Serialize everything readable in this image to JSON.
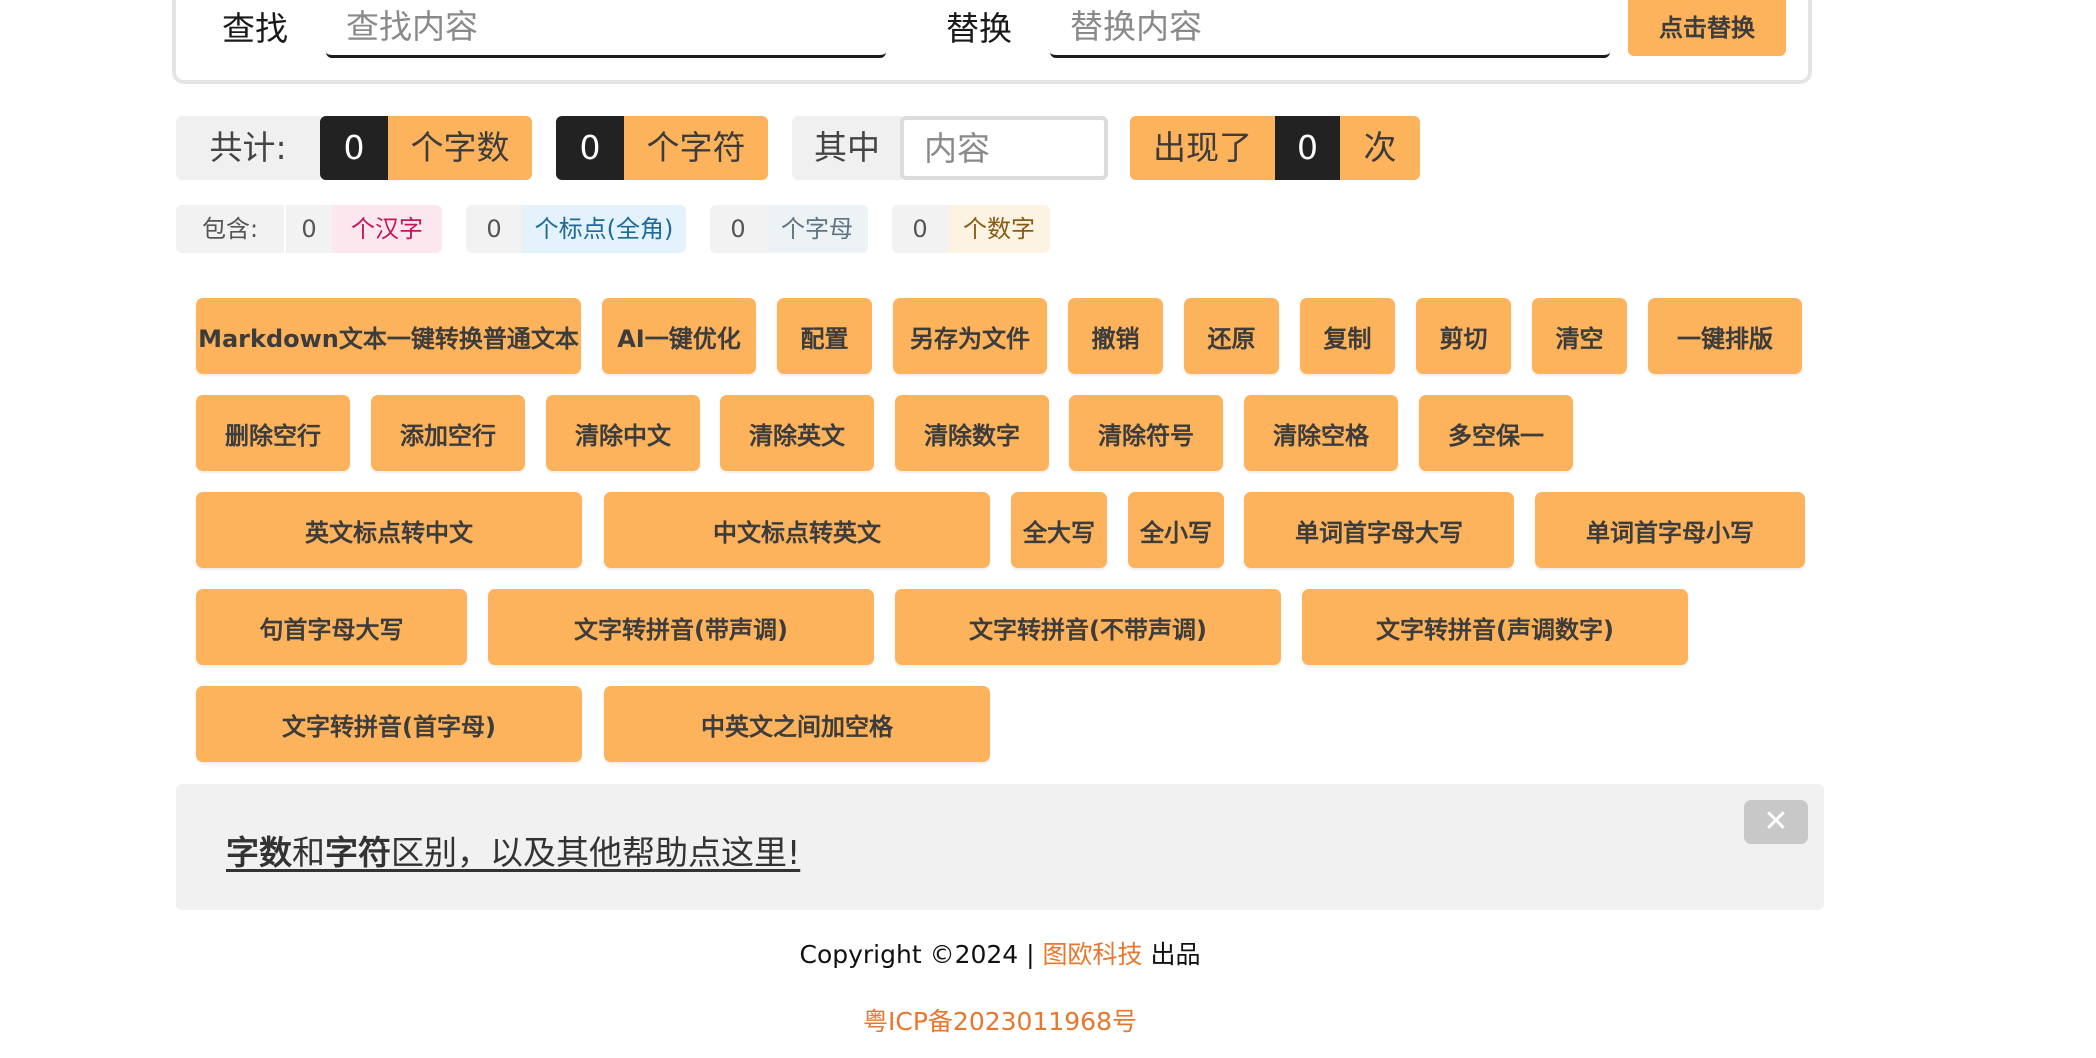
{
  "find_panel": {
    "find_label": "查找",
    "find_placeholder": "查找内容",
    "replace_label": "替换",
    "replace_placeholder": "替换内容",
    "replace_button": "点击替换"
  },
  "counts": {
    "total_label": "共计:",
    "word_count": "0",
    "word_unit": "个字数",
    "char_count": "0",
    "char_unit": "个字符",
    "within_label": "其中",
    "within_placeholder": "内容",
    "appear_label": "出现了",
    "appear_count": "0",
    "appear_unit": "次"
  },
  "contains": {
    "label": "包含:",
    "items": [
      {
        "count": "0",
        "unit": "个汉字",
        "bg": "#fde7ee",
        "color": "#c2185b"
      },
      {
        "count": "0",
        "unit": "个标点(全角)",
        "bg": "#e3f2fb",
        "color": "#1f6a99"
      },
      {
        "count": "0",
        "unit": "个字母",
        "bg": "#edf2f5",
        "color": "#5f7382"
      },
      {
        "count": "0",
        "unit": "个数字",
        "bg": "#fdf3e2",
        "color": "#8a5b17"
      }
    ]
  },
  "tools": [
    "Markdown文本一键转换普通文本",
    "AI一键优化",
    "配置",
    "另存为文件",
    "撤销",
    "还原",
    "复制",
    "剪切",
    "清空",
    "一键排版",
    "删除空行",
    "添加空行",
    "清除中文",
    "清除英文",
    "清除数字",
    "清除符号",
    "清除空格",
    "多空保一",
    "英文标点转中文",
    "中文标点转英文",
    "全大写",
    "全小写",
    "单词首字母大写",
    "单词首字母小写",
    "句首字母大写",
    "文字转拼音(带声调)",
    "文字转拼音(不带声调)",
    "文字转拼音(声调数字)",
    "文字转拼音(首字母)",
    "中英文之间加空格"
  ],
  "help": {
    "part1": "字数",
    "part2": "和",
    "part3": "字符",
    "part4": "区别，以及其他帮助点这里!",
    "close": "✕"
  },
  "footer": {
    "copyright": "Copyright ©2024 | ",
    "company": "图欧科技",
    "suffix": " 出品",
    "icp": "粤ICP备2023011968号"
  },
  "colors": {
    "accent": "#fdb25c",
    "dark": "#222222",
    "link": "#e8772e"
  }
}
